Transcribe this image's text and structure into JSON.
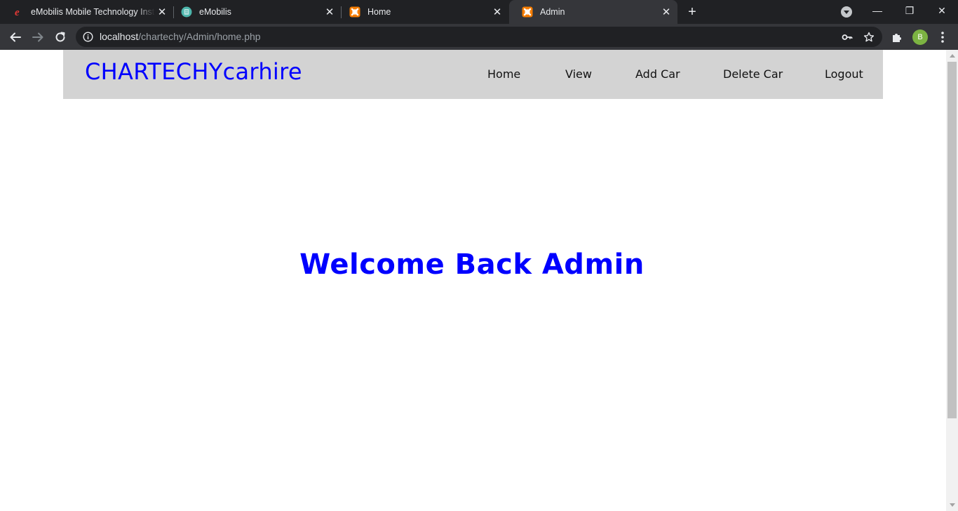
{
  "browser": {
    "tabs": [
      {
        "title": "eMobilis Mobile Technology Institute",
        "favicon": "emobilis-e-icon",
        "active": false
      },
      {
        "title": "eMobilis",
        "favicon": "emobilis-globe-icon",
        "active": false
      },
      {
        "title": "Home",
        "favicon": "xampp-icon",
        "active": false
      },
      {
        "title": "Admin",
        "favicon": "xampp-icon",
        "active": true
      }
    ],
    "new_tab_label": "+",
    "address_bar": {
      "host": "localhost",
      "path": "/chartechy/Admin/home.php"
    },
    "profile_initial": "B",
    "window_controls": {
      "minimize": "—",
      "restore": "❐",
      "close": "✕"
    },
    "colors": {
      "tabstrip": "#202124",
      "toolbar": "#35363a",
      "profile": "#7cb342"
    }
  },
  "site": {
    "logo": "CHARTECHYcarhire",
    "nav": [
      "Home",
      "View",
      "Add Car",
      "Delete Car",
      "Logout"
    ],
    "welcome": "Welcome Back Admin",
    "colors": {
      "accent": "#0000ff",
      "header_bg": "#d3d3d3"
    }
  }
}
